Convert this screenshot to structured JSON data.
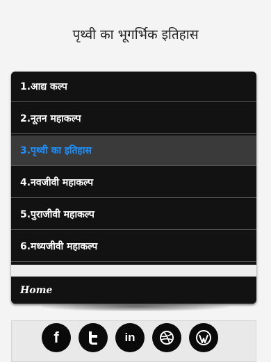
{
  "header": {
    "title": "पृथ्वी का भूगर्भिक इतिहास"
  },
  "menu": {
    "items": [
      {
        "label": "1.आद्य कल्प",
        "active": false
      },
      {
        "label": "2.नूतन महाकल्प",
        "active": false
      },
      {
        "label": "3.पृथ्वी का इतिहास",
        "active": true
      },
      {
        "label": "4.नवजीवी महाकल्प",
        "active": false
      },
      {
        "label": "5.पुराजीवी महाकल्प",
        "active": false
      },
      {
        "label": "6.मध्यजीवी महाकल्प",
        "active": false
      }
    ],
    "home_label": "Home"
  },
  "social": {
    "icons": [
      "facebook-icon",
      "twitter-icon",
      "linkedin-icon",
      "dribbble-icon",
      "wordpress-icon"
    ],
    "glyphs": {
      "facebook": "f",
      "linkedin": "in"
    }
  },
  "colors": {
    "active_text": "#1e90ff",
    "menu_bg": "#121212"
  }
}
